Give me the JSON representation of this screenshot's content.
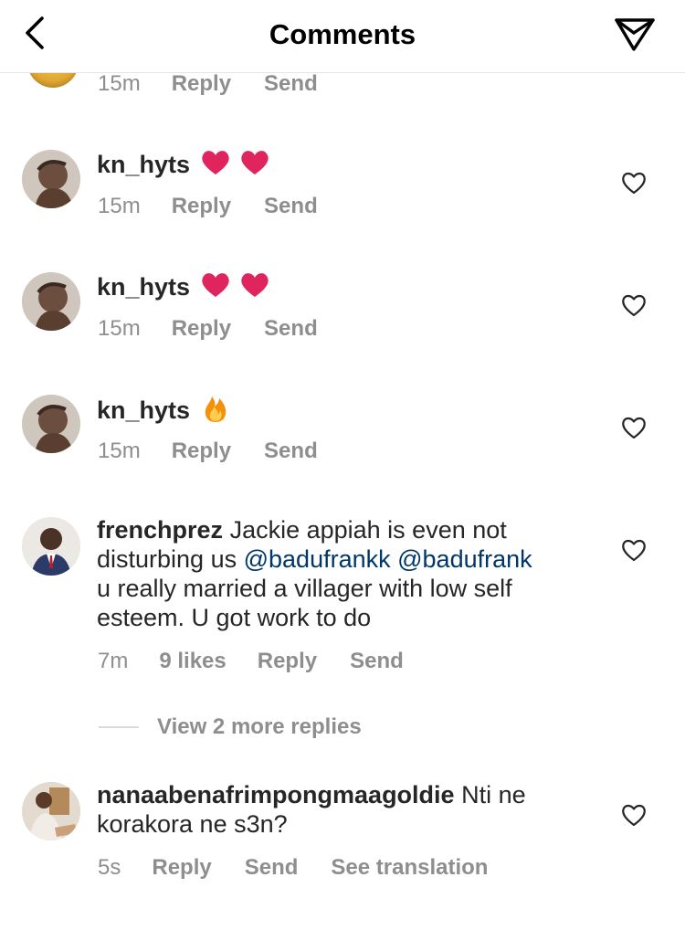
{
  "header": {
    "title": "Comments"
  },
  "top_row": {
    "time": "15m",
    "reply": "Reply",
    "send": "Send"
  },
  "comments": [
    {
      "username": "kn_hyts",
      "time": "15m",
      "reply": "Reply",
      "send": "Send",
      "emoji": [
        "heart",
        "heart"
      ]
    },
    {
      "username": "kn_hyts",
      "time": "15m",
      "reply": "Reply",
      "send": "Send",
      "emoji": [
        "heart",
        "heart"
      ]
    },
    {
      "username": "kn_hyts",
      "time": "15m",
      "reply": "Reply",
      "send": "Send",
      "emoji": [
        "fire"
      ]
    },
    {
      "username": "frenchprez",
      "text_line1": "Jackie appiah is even not",
      "text_line2_prefix": "disturbing us",
      "mention1": "@badufrankk",
      "mention2": "@badufrank",
      "text_line3": "u really married a villager with low self",
      "text_line4": "esteem. U got work to do",
      "time": "7m",
      "likes": "9 likes",
      "reply": "Reply",
      "send": "Send",
      "view_replies": "View 2 more replies"
    },
    {
      "username": "nanaabenafrimpongmaagoldie",
      "text_line1": "Nti ne",
      "text_line2": "korakora ne s3n?",
      "time": "5s",
      "reply": "Reply",
      "send": "Send",
      "translate": "See translation"
    }
  ],
  "icons": {
    "back": "chevron-left-icon",
    "direct": "paper-plane-icon",
    "like": "heart-outline-icon",
    "heart_emoji": "red-heart-emoji",
    "fire_emoji": "fire-emoji"
  },
  "colors": {
    "meta": "#8e8e8e",
    "mention": "#00376b",
    "text": "#262626",
    "heart": "#e0245e"
  }
}
